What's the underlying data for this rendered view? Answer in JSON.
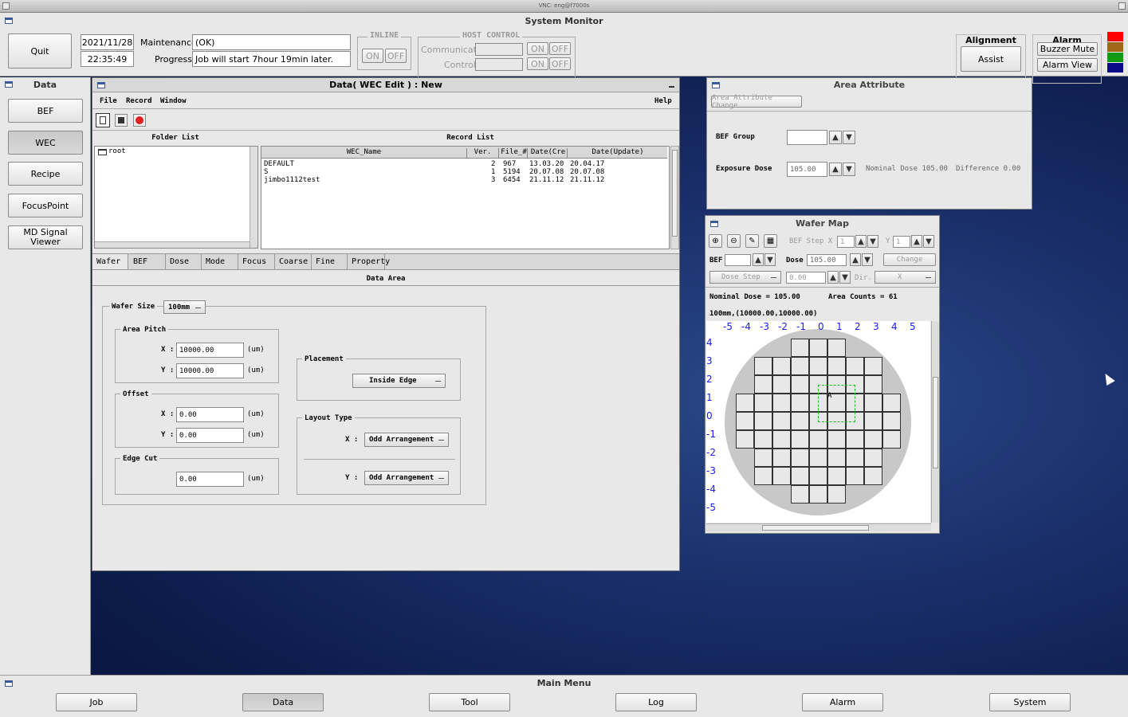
{
  "vnc_title": "VNC: eng@f7000s",
  "system_monitor": {
    "title": "System Monitor",
    "quit_label": "Quit",
    "date": "2021/11/28",
    "time": "22:35:49",
    "maintenance_label": "Maintenance:",
    "maintenance_value": "(OK)",
    "progress_label": "Progress:",
    "progress_value": "Job will start 7hour 19min later.",
    "inline": {
      "title": "INLINE",
      "on": "ON",
      "off": "OFF"
    },
    "host_control": {
      "title": "HOST CONTROL",
      "communicate": "Communicate",
      "control": "Control:",
      "on": "ON",
      "off": "OFF"
    },
    "alignment": {
      "title": "Alignment",
      "assist": "Assist"
    },
    "alarm": {
      "title": "Alarm",
      "buzzer_mute": "Buzzer Mute",
      "alarm_view": "Alarm View"
    },
    "status_colors": [
      "#ff0000",
      "#a0661a",
      "#139a13",
      "#0a0a8a"
    ]
  },
  "data_sidebar": {
    "title": "Data",
    "items": [
      {
        "label": "BEF",
        "active": false
      },
      {
        "label": "WEC",
        "active": true
      },
      {
        "label": "Recipe",
        "active": false
      },
      {
        "label": "FocusPoint",
        "active": false
      },
      {
        "label": "MD Signal Viewer",
        "active": false
      }
    ]
  },
  "wec_edit": {
    "title": "Data( WEC Edit ) : New",
    "menu": [
      "File",
      "Record",
      "Window"
    ],
    "help": "Help",
    "folder_list_title": "Folder List",
    "folder_root": "root",
    "record_list_title": "Record List",
    "columns": [
      "WEC_Name",
      "Ver.",
      "File_#",
      "Date(Cre",
      "Date(Update)"
    ],
    "records": [
      {
        "name": "DEFAULT",
        "ver": "2",
        "file": "967",
        "created": "13.03.20",
        "updated": "20.04.17"
      },
      {
        "name": "S",
        "ver": "1",
        "file": "5194",
        "created": "20.07.08",
        "updated": "20.07.08"
      },
      {
        "name": "jimbo1112test",
        "ver": "3",
        "file": "6454",
        "created": "21.11.12",
        "updated": "21.11.12"
      }
    ],
    "tabs": [
      "Wafer",
      "BEF",
      "Dose",
      "Mode",
      "Focus",
      "Coarse",
      "Fine",
      "Property"
    ],
    "data_area_title": "Data Area",
    "wafer_size_label": "Wafer Size",
    "wafer_size_value": "100mm",
    "area_pitch": {
      "title": "Area Pitch",
      "x_label": "X :",
      "x_value": "10000.00",
      "y_label": "Y :",
      "y_value": "10000.00",
      "unit": "(um)"
    },
    "offset": {
      "title": "Offset",
      "x_label": "X :",
      "x_value": "0.00",
      "y_label": "Y :",
      "y_value": "0.00",
      "unit": "(um)"
    },
    "edge_cut": {
      "title": "Edge Cut",
      "value": "0.00",
      "unit": "(um)"
    },
    "placement": {
      "title": "Placement",
      "value": "Inside Edge"
    },
    "layout_type": {
      "title": "Layout Type",
      "x_label": "X :",
      "x_value": "Odd Arrangement",
      "y_label": "Y :",
      "y_value": "Odd Arrangement"
    }
  },
  "area_attribute": {
    "title": "Area Attribute",
    "change_button": "Area Attribute Change",
    "bef_group_label": "BEF Group",
    "bef_group_value": "",
    "exposure_dose_label": "Exposure Dose",
    "exposure_dose_value": "105.00",
    "nominal_dose": "Nominal Dose 105.00",
    "difference": "Difference 0.00"
  },
  "wafer_map": {
    "title": "Wafer Map",
    "bef_step_x_label": "BEF Step X",
    "bef_step_x": "1",
    "y_label": "Y",
    "y_value": "1",
    "bef_label": "BEF",
    "bef_value": "",
    "dose_label": "Dose",
    "dose_value": "105.00",
    "change_label": "Change",
    "dose_step_label": "Dose Step",
    "dose_step_value": "0.00",
    "dir_label": "Dir.",
    "dir_value": "X",
    "nominal_dose_text": "Nominal Dose = 105.00",
    "area_counts_text": "Area Counts = 61",
    "info_text": "100mm,(10000.00,10000.00)",
    "x_axis": [
      "-5",
      "-4",
      "-3",
      "-2",
      "-1",
      "0",
      "1",
      "2",
      "3",
      "4",
      "5"
    ],
    "y_axis": [
      "4",
      "3",
      "2",
      "1",
      "0",
      "-1",
      "-2",
      "-3",
      "-4",
      "-5"
    ],
    "row_spans": [
      [
        -1,
        1
      ],
      [
        -3,
        3
      ],
      [
        -3,
        3
      ],
      [
        -4,
        4
      ],
      [
        -4,
        4
      ],
      [
        -4,
        4
      ],
      [
        -3,
        3
      ],
      [
        -3,
        3
      ],
      [
        -1,
        1
      ]
    ],
    "marker_label": "A"
  },
  "main_menu": {
    "title": "Main Menu",
    "items": [
      {
        "label": "Job",
        "active": false
      },
      {
        "label": "Data",
        "active": true
      },
      {
        "label": "Tool",
        "active": false
      },
      {
        "label": "Log",
        "active": false
      },
      {
        "label": "Alarm",
        "active": false
      },
      {
        "label": "System",
        "active": false
      }
    ]
  }
}
